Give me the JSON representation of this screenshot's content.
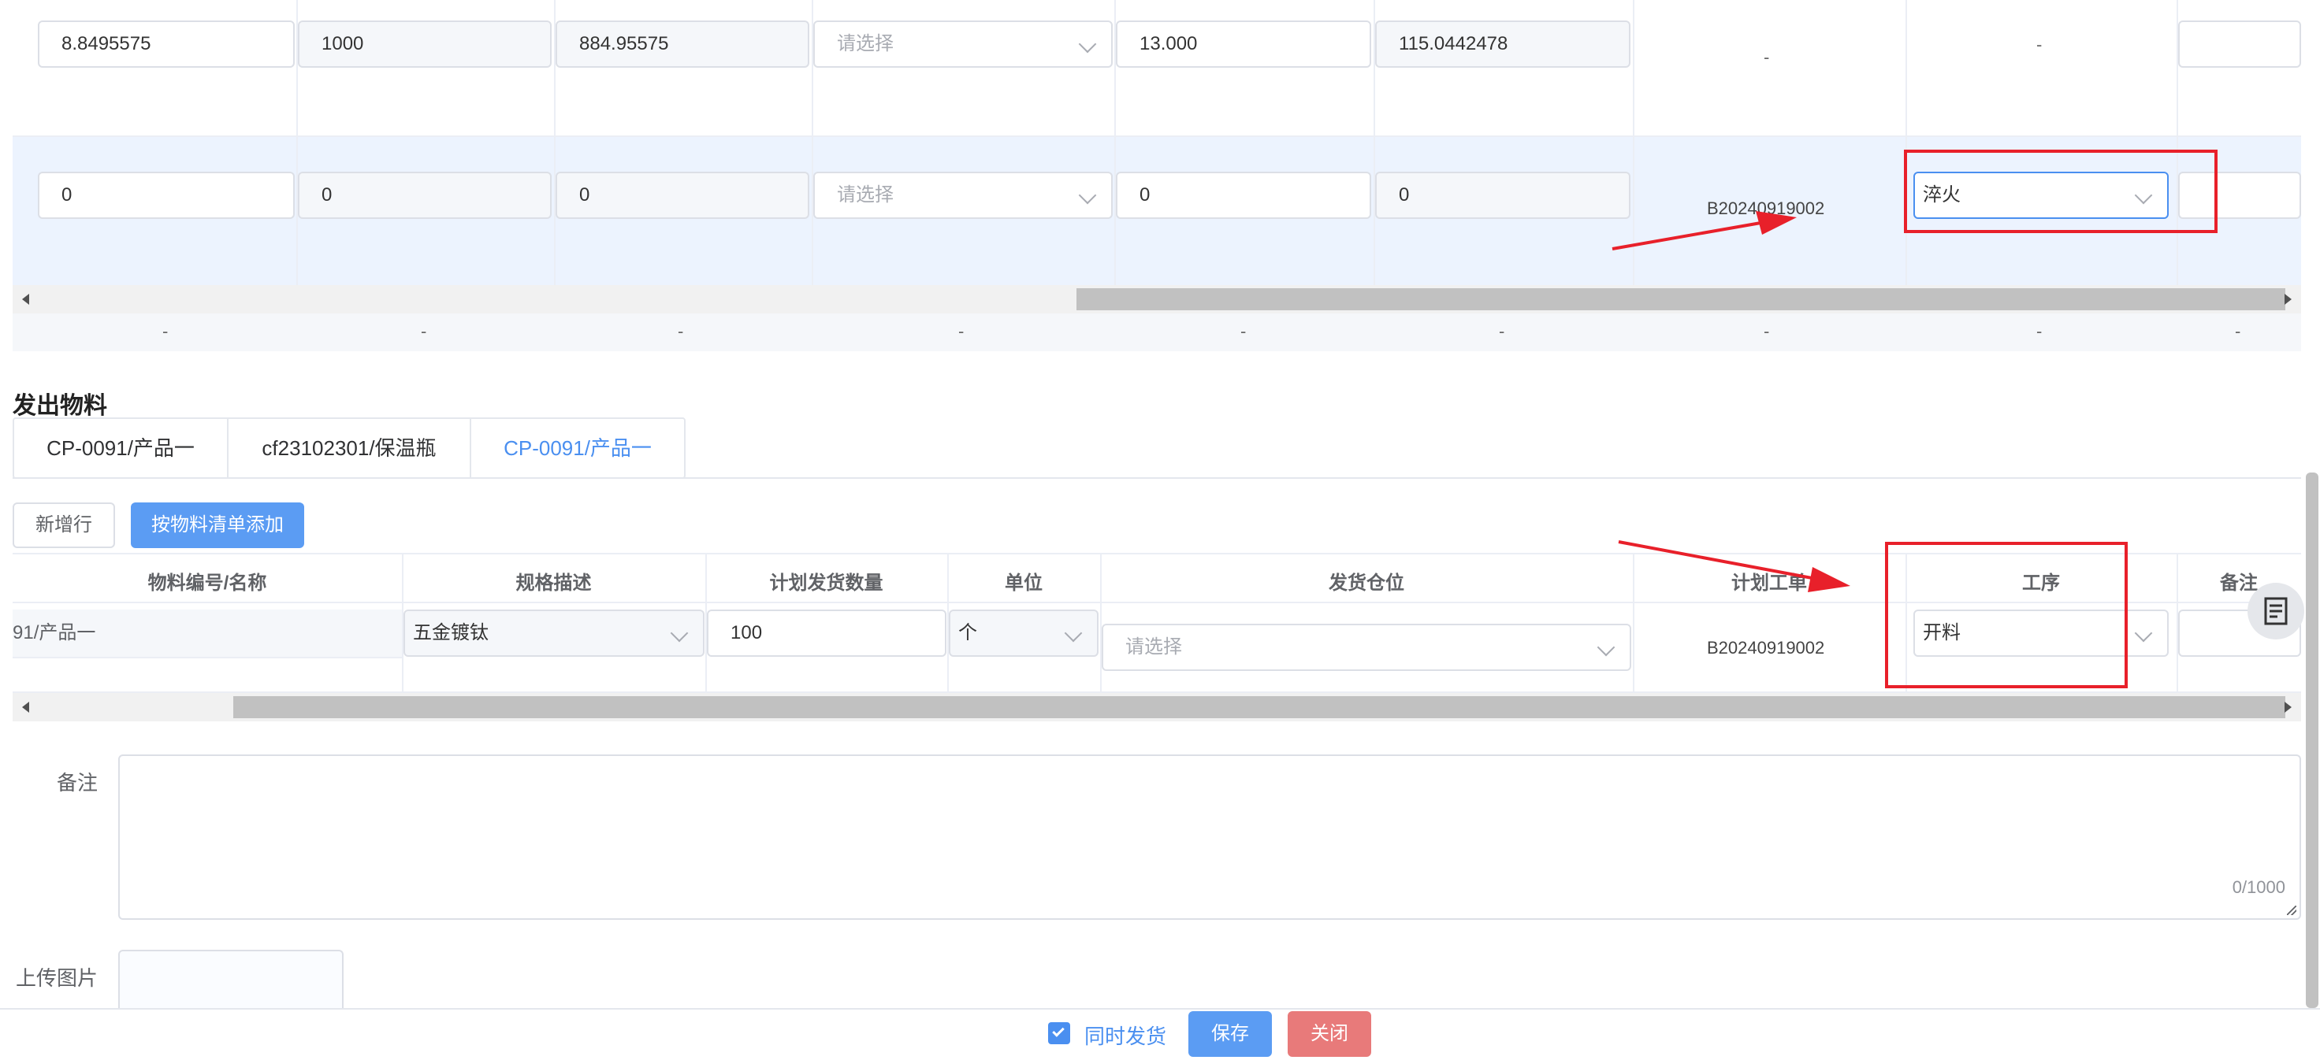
{
  "table1": {
    "row1": {
      "c1": "8.8495575",
      "c2": "1000",
      "c3": "884.95575",
      "c4_placeholder": "请选择",
      "c5": "13.000",
      "c6": "115.0442478",
      "c7": "-",
      "c8": "-"
    },
    "row2": {
      "c1": "0",
      "c2": "0",
      "c3": "0",
      "c4_placeholder": "请选择",
      "c5": "0",
      "c6": "0",
      "c7": "B20240919002",
      "c8": "淬火"
    },
    "summary": "-"
  },
  "section_title": "发出物料",
  "tabs": [
    "CP-0091/产品一",
    "cf23102301/保温瓶",
    "CP-0091/产品一"
  ],
  "buttons": {
    "add_row": "新增行",
    "add_by_bom": "按物料清单添加"
  },
  "table2": {
    "headers": [
      "物料编号/名称",
      "规格描述",
      "计划发货数量",
      "单位",
      "发货仓位",
      "计划工单",
      "工序",
      "备注"
    ],
    "row": {
      "material": "91/产品一",
      "spec": "五金镀钛",
      "qty": "100",
      "unit": "个",
      "warehouse_placeholder": "请选择",
      "work_order": "B20240919002",
      "process": "开料"
    }
  },
  "remark": {
    "label": "备注",
    "counter": "0/1000"
  },
  "upload": {
    "label": "上传图片"
  },
  "footer": {
    "checkbox_label": "同时发货",
    "save": "保存",
    "close": "关闭"
  },
  "colors": {
    "primary": "#4a8ff0",
    "danger": "#e87a7a",
    "highlight_row": "#ecf3fe",
    "annotation": "#e8202a"
  }
}
